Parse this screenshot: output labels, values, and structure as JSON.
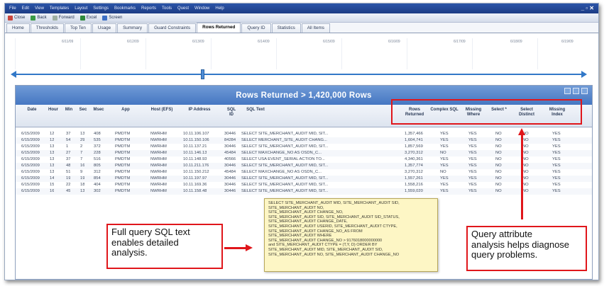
{
  "menu": [
    "File",
    "Edit",
    "View",
    "Templates",
    "Layout",
    "Settings",
    "Bookmarks",
    "Reports",
    "Tools",
    "Quest",
    "Window",
    "Help"
  ],
  "toolbar": {
    "items": [
      "Close",
      "Back",
      "Forward",
      "Excel",
      "Screen"
    ]
  },
  "tabs": [
    "Home",
    "Thresholds",
    "Top Ten",
    "Usage",
    "Summary",
    "Guard Constraints",
    "Rows Returned",
    "Query ID",
    "Statistics",
    "All Items"
  ],
  "timeline": {
    "ticks": [
      "6/11/09",
      "6/12/09",
      "6/13/09",
      "6/14/09",
      "6/15/09",
      "6/16/09",
      "6/17/09",
      "6/18/09",
      "6/19/09"
    ]
  },
  "panel": {
    "title": "Rows Returned > 1,420,000 Rows"
  },
  "columns": {
    "date": "Date",
    "hour": "Hour",
    "min": "Min",
    "sec": "Sec",
    "msec": "Msec",
    "app": "App",
    "host": "Host (EFS)",
    "ip": "IP Address",
    "sql_id": "SQL ID",
    "sql_text": "SQL Text",
    "rows_returned": "Rows Returned",
    "complex_sql": "Complex SQL",
    "missing_where": "Missing Where",
    "select_star": "Select *",
    "select_distinct": "Select Distinct",
    "missing_index": "Missing Index"
  },
  "rows": [
    {
      "date": "6/15/2009",
      "hour": "12",
      "min": "37",
      "sec": "13",
      "msec": "408",
      "app": "PMDTM",
      "host": "NWRHM",
      "ip": "10.11.106.107",
      "sql_id": "30446",
      "sql": "SELECT SITE_MERCHANT_AUDIT MID, SIT...",
      "rows": "1,357,466",
      "complex": "YES",
      "missing_where": "YES",
      "star": "NO",
      "distinct": "NO",
      "index": "YES"
    },
    {
      "date": "6/15/2009",
      "hour": "12",
      "min": "54",
      "sec": "29",
      "msec": "535",
      "app": "PMDTM",
      "host": "NWRHM",
      "ip": "10.11.150.106",
      "sql_id": "84284",
      "sql": "SELECT MERCHANT_SITE_AUDIT CHANG...",
      "rows": "1,604,741",
      "complex": "YES",
      "missing_where": "YES",
      "star": "NO",
      "distinct": "NO",
      "index": "YES"
    },
    {
      "date": "6/15/2009",
      "hour": "13",
      "min": "1",
      "sec": "2",
      "msec": "372",
      "app": "PMDTM",
      "host": "NWRHM",
      "ip": "10.11.137.21",
      "sql_id": "30446",
      "sql": "SELECT SITE_MERCHANT_AUDIT MID, SIT...",
      "rows": "1,857,569",
      "complex": "YES",
      "missing_where": "YES",
      "star": "NO",
      "distinct": "NO",
      "index": "YES"
    },
    {
      "date": "6/15/2009",
      "hour": "13",
      "min": "27",
      "sec": "7",
      "msec": "228",
      "app": "PMDTM",
      "host": "NWRHM",
      "ip": "10.11.146.13",
      "sql_id": "45484",
      "sql": "SELECT MAXCHANGE_NO AS OSDN_C...",
      "rows": "3,270,312",
      "complex": "NO",
      "missing_where": "YES",
      "star": "NO",
      "distinct": "NO",
      "index": "YES"
    },
    {
      "date": "6/15/2009",
      "hour": "13",
      "min": "37",
      "sec": "7",
      "msec": "516",
      "app": "PMDTM",
      "host": "NWRHM",
      "ip": "10.11.148.93",
      "sql_id": "40566",
      "sql": "SELECT USA EVENT_SERIAL ACTION TO...",
      "rows": "4,340,361",
      "complex": "YES",
      "missing_where": "YES",
      "star": "NO",
      "distinct": "NO",
      "index": "YES"
    },
    {
      "date": "6/15/2009",
      "hour": "13",
      "min": "48",
      "sec": "16",
      "msec": "805",
      "app": "PMDTM",
      "host": "NWRHM",
      "ip": "10.11.211.176",
      "sql_id": "30446",
      "sql": "SELECT SITE_MERCHANT_AUDIT MID, SIT...",
      "rows": "1,357,774",
      "complex": "YES",
      "missing_where": "YES",
      "star": "NO",
      "distinct": "NO",
      "index": "YES"
    },
    {
      "date": "6/15/2009",
      "hour": "13",
      "min": "51",
      "sec": "9",
      "msec": "312",
      "app": "PMDTM",
      "host": "NWRHM",
      "ip": "10.11.150.212",
      "sql_id": "45484",
      "sql": "SELECT MAXCHANGE_NO AS OSDN_C...",
      "rows": "3,270,312",
      "complex": "NO",
      "missing_where": "YES",
      "star": "NO",
      "distinct": "NO",
      "index": "YES"
    },
    {
      "date": "6/15/2009",
      "hour": "14",
      "min": "19",
      "sec": "19",
      "msec": "854",
      "app": "PMDTM",
      "host": "NWRHM",
      "ip": "10.11.197.97",
      "sql_id": "30446",
      "sql": "SELECT SITE_MERCHANT_AUDIT MID, SIT...",
      "rows": "1,557,261",
      "complex": "YES",
      "missing_where": "YES",
      "star": "NO",
      "distinct": "NO",
      "index": "YES"
    },
    {
      "date": "6/15/2009",
      "hour": "15",
      "min": "22",
      "sec": "18",
      "msec": "404",
      "app": "PMDTM",
      "host": "NWRHM",
      "ip": "10.11.169.36",
      "sql_id": "30446",
      "sql": "SELECT SITE_MERCHANT_AUDIT MID, SIT...",
      "rows": "1,558,216",
      "complex": "YES",
      "missing_where": "YES",
      "star": "NO",
      "distinct": "NO",
      "index": "YES"
    },
    {
      "date": "6/15/2009",
      "hour": "16",
      "min": "45",
      "sec": "13",
      "msec": "302",
      "app": "PMDTM",
      "host": "NWRHM",
      "ip": "10.11.158.48",
      "sql_id": "30446",
      "sql": "SELECT SITE_MERCHANT_AUDIT MID, SIT...",
      "rows": "1,559,020",
      "complex": "YES",
      "missing_where": "YES",
      "star": "NO",
      "distinct": "NO",
      "index": "YES"
    }
  ],
  "tooltip_lines": [
    "SELECT SITE_MERCHANT_AUDIT MID, SITE_MERCHANT_AUDIT SID,",
    "SITE_MERCHANT_AUDIT NO,",
    "SITE_MERCHANT_AUDIT CHANGE_NO,",
    "SITE_MERCHANT_AUDIT SID, SITE_MERCHANT_AUDIT SID_STATUS,",
    "SITE_MERCHANT_AUDIT CHANGE_DATE,",
    "SITE_MERCHANT_AUDIT USERID, SITE_MERCHANT_AUDIT CTYPE,",
    "SITE_MERCHANT_AUDIT CHANGE_NO_AS FROM",
    "SITE_MERCHANT_AUDIT WHERE",
    "SITE_MERCHANT_AUDIT CHANGE_NO > 9176018000000000",
    "and SITE_MERCHANT_AUDIT CTYPE = (T,Y, D) ORDER BY",
    "SITE_MERCHANT_AUDIT MID, SITE_MERCHANT_AUDIT SID,",
    "SITE_MERCHANT_AUDIT NO, SITE_MERCHANT_AUDIT CHANGE_NO"
  ],
  "callouts": {
    "left": [
      "Full query SQL text",
      "enables detailed",
      "analysis."
    ],
    "right": [
      "Query attribute",
      "analysis helps diagnose",
      "query problems."
    ]
  },
  "colors": {
    "annotation_red": "#e0161b",
    "panel_header_blue": "#4677c2",
    "tooltip_yellow": "#fdf6c5"
  }
}
